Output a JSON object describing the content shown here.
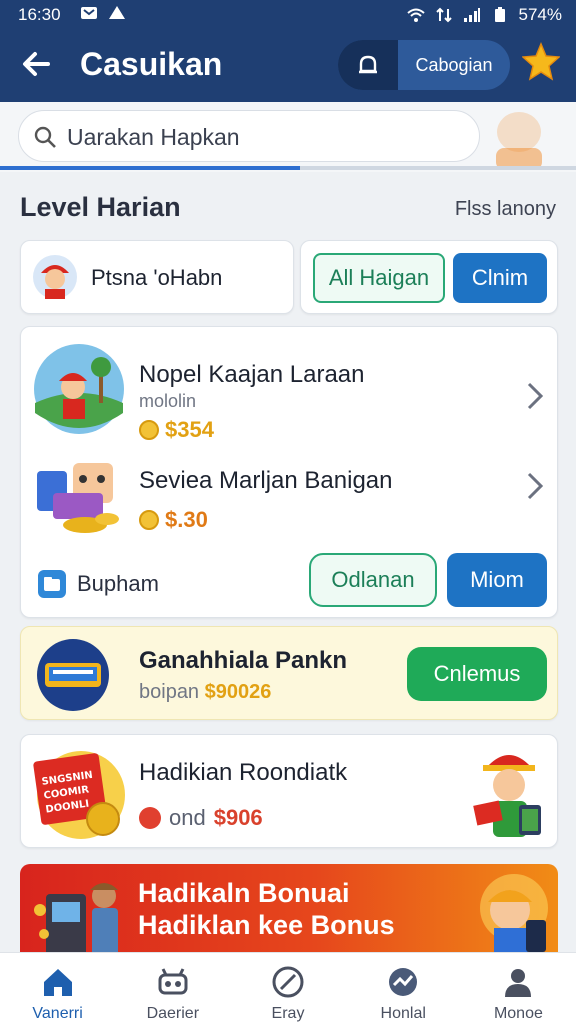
{
  "status": {
    "time": "16:30",
    "battery": "574%"
  },
  "header": {
    "title": "Casuikan",
    "segment_label": "Cabogian"
  },
  "search": {
    "placeholder": "Uarakan Hapkan",
    "progress": 0.52
  },
  "section": {
    "title": "Level Harian",
    "right_text": "Flss lanony"
  },
  "user": {
    "name": "Ptsna 'oHabn"
  },
  "actions": {
    "all_label": "All Haigan",
    "claim_label": "Clnim"
  },
  "items": [
    {
      "name": "Nopel Kaajan Laraan",
      "subtitle": "mololin",
      "price": "$354"
    },
    {
      "name": "Seviea Marljan Banigan",
      "subtitle": "",
      "price": "$.30"
    }
  ],
  "list_footer": {
    "label": "Bupham",
    "outline_label": "Odlanan",
    "blue_label": "Miom"
  },
  "promo1": {
    "title": "Ganahhiala Pankn",
    "subtitle_prefix": "boipan",
    "amount": "$90026",
    "button": "Cnlemus"
  },
  "promo2": {
    "title": "Hadikian Roondiatk",
    "subtitle_prefix": "ond",
    "amount": "$906",
    "image_text": "SNGSNIN COOMIR DOONLI"
  },
  "banner": {
    "line1": "Hadikaln Bonuai",
    "line2": "Hadiklan kee Bonus"
  },
  "nav": [
    {
      "label": "Vanerri",
      "icon": "home-icon"
    },
    {
      "label": "Daerier",
      "icon": "robot-icon"
    },
    {
      "label": "Eray",
      "icon": "circle-x-icon"
    },
    {
      "label": "Honlal",
      "icon": "chart-icon"
    },
    {
      "label": "Monoe",
      "icon": "person-icon"
    }
  ],
  "colors": {
    "header": "#1f3f73",
    "accent_blue": "#1e73c4",
    "accent_green": "#1faa58",
    "gold": "#e2a113"
  }
}
